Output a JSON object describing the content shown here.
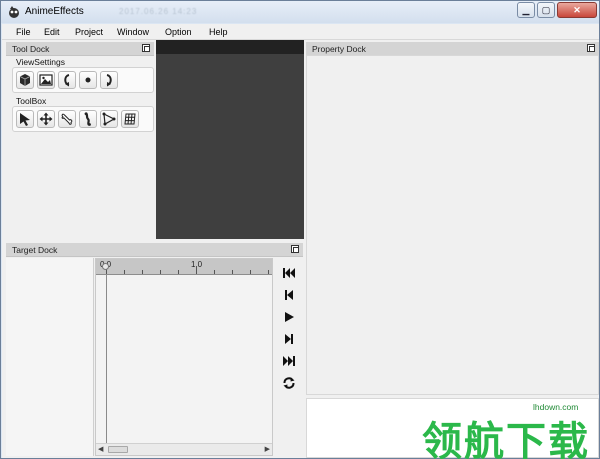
{
  "window": {
    "title": "AnimeEffects",
    "blurred_title_suffix": "2017.06.26 14:23",
    "controls": {
      "minimize": "▁",
      "maximize": "▢",
      "close": "✕"
    }
  },
  "menu": {
    "items": [
      "File",
      "Edit",
      "Project",
      "Window",
      "Option",
      "Help"
    ]
  },
  "tool_dock": {
    "title": "Tool Dock",
    "view_settings_label": "ViewSettings",
    "view_icons": [
      "cube-icon",
      "image-icon",
      "rotate-left-icon",
      "dot-icon",
      "rotate-right-icon"
    ],
    "toolbox_label": "ToolBox",
    "tool_icons": [
      "cursor-icon",
      "move-icon",
      "bone-icon",
      "pose-icon",
      "mesh-icon",
      "ffd-grid-icon"
    ]
  },
  "target_dock": {
    "title": "Target Dock",
    "ruler_start": "0.0",
    "ruler_mark": "1.0"
  },
  "playback": {
    "buttons": [
      "skip-to-start-icon",
      "step-back-icon",
      "play-icon",
      "step-forward-icon",
      "skip-to-end-icon",
      "loop-icon"
    ]
  },
  "property_dock": {
    "title": "Property Dock"
  },
  "watermark": {
    "chinese": "领航下载",
    "url": "lhdown.com"
  }
}
